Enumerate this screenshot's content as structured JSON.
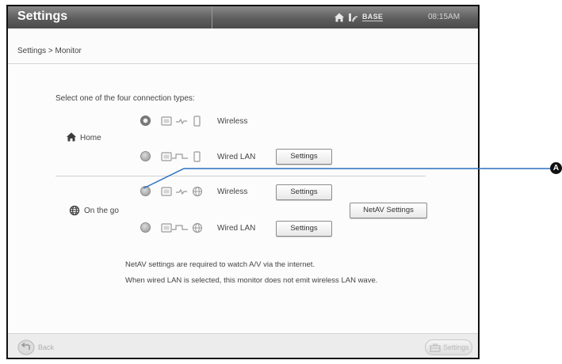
{
  "window": {
    "title": "Settings"
  },
  "status": {
    "base_label": "BASE",
    "clock": "08:15AM"
  },
  "breadcrumb": "Settings > Monitor",
  "instruction": "Select one of the four connection types:",
  "groups": {
    "home": {
      "label": "Home",
      "options": [
        {
          "label": "Wireless",
          "selected": true
        },
        {
          "label": "Wired LAN",
          "button": "Settings"
        }
      ]
    },
    "on_the_go": {
      "label": "On the go",
      "options": [
        {
          "label": "Wireless",
          "button": "Settings"
        },
        {
          "label": "Wired LAN",
          "button": "Settings"
        }
      ],
      "netav_button": "NetAV Settings"
    }
  },
  "notes": [
    "NetAV settings are required to watch A/V via the internet.",
    "When wired LAN is selected, this monitor does not emit wireless LAN wave."
  ],
  "bottom": {
    "back_label": "Back",
    "settings_label": "Settings"
  },
  "callout": {
    "label": "A"
  }
}
